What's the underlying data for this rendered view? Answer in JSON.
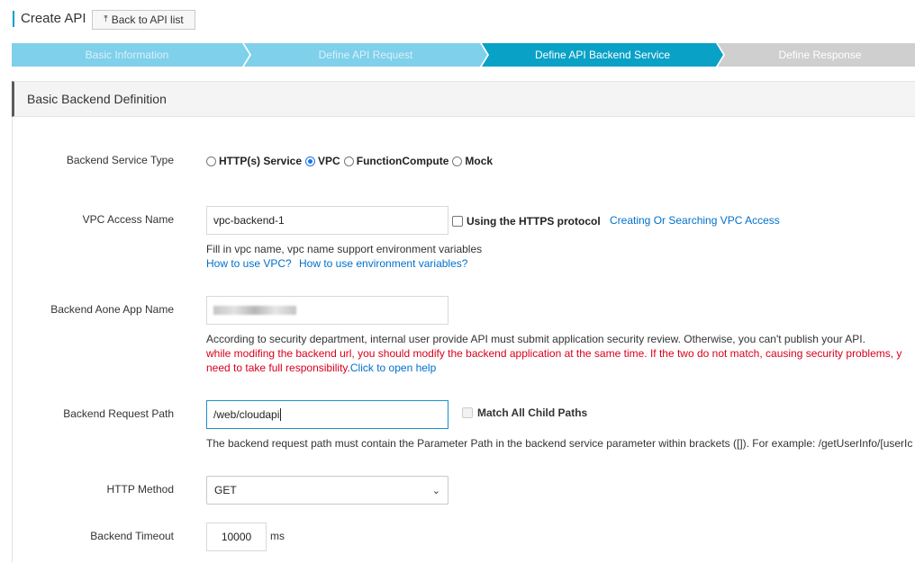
{
  "header": {
    "title": "Create API",
    "back_label": "Back to API list",
    "back_icon": "upload-arrow-icon"
  },
  "steps": [
    {
      "label": "Basic Information",
      "state": "done"
    },
    {
      "label": "Define API Request",
      "state": "done"
    },
    {
      "label": "Define API Backend Service",
      "state": "active"
    },
    {
      "label": "Define Response",
      "state": "todo"
    }
  ],
  "colors": {
    "step_done": "#7fd0ea",
    "step_active": "#0aa1c7",
    "step_todo": "#cfcfcf",
    "link": "#0070cc",
    "warning": "#d9001b"
  },
  "section": {
    "title": "Basic Backend Definition"
  },
  "service_type": {
    "label": "Backend Service Type",
    "options": [
      {
        "label": "HTTP(s) Service",
        "selected": false
      },
      {
        "label": "VPC",
        "selected": true
      },
      {
        "label": "FunctionCompute",
        "selected": false
      },
      {
        "label": "Mock",
        "selected": false
      }
    ]
  },
  "vpc": {
    "label": "VPC Access Name",
    "value": "vpc-backend-1",
    "https_label": "Using the HTTPS protocol",
    "https_checked": false,
    "create_link": "Creating Or Searching VPC Access",
    "help": "Fill in vpc name, vpc name support environment variables",
    "link1": "How to use VPC?",
    "link2": "How to use environment variables?"
  },
  "aone": {
    "label": "Backend Aone App Name",
    "value_redacted": true,
    "help": "According to security department, internal user provide API must submit application security review. Otherwise, you can't publish your API.",
    "warn_line1": "while modifing the backend url, you should modify the backend application at the same time. If the two do not match, causing security problems, y",
    "warn_line2": "need to take full responsibility.",
    "help_link": "Click to open help"
  },
  "path": {
    "label": "Backend Request Path",
    "value": "/web/cloudapi",
    "match_label": "Match All Child Paths",
    "match_checked": false,
    "help": "The backend request path must contain the Parameter Path in the backend service parameter within brackets ([]). For example: /getUserInfo/[userIc"
  },
  "method": {
    "label": "HTTP Method",
    "value": "GET"
  },
  "timeout": {
    "label": "Backend Timeout",
    "value": "10000",
    "unit": "ms"
  }
}
